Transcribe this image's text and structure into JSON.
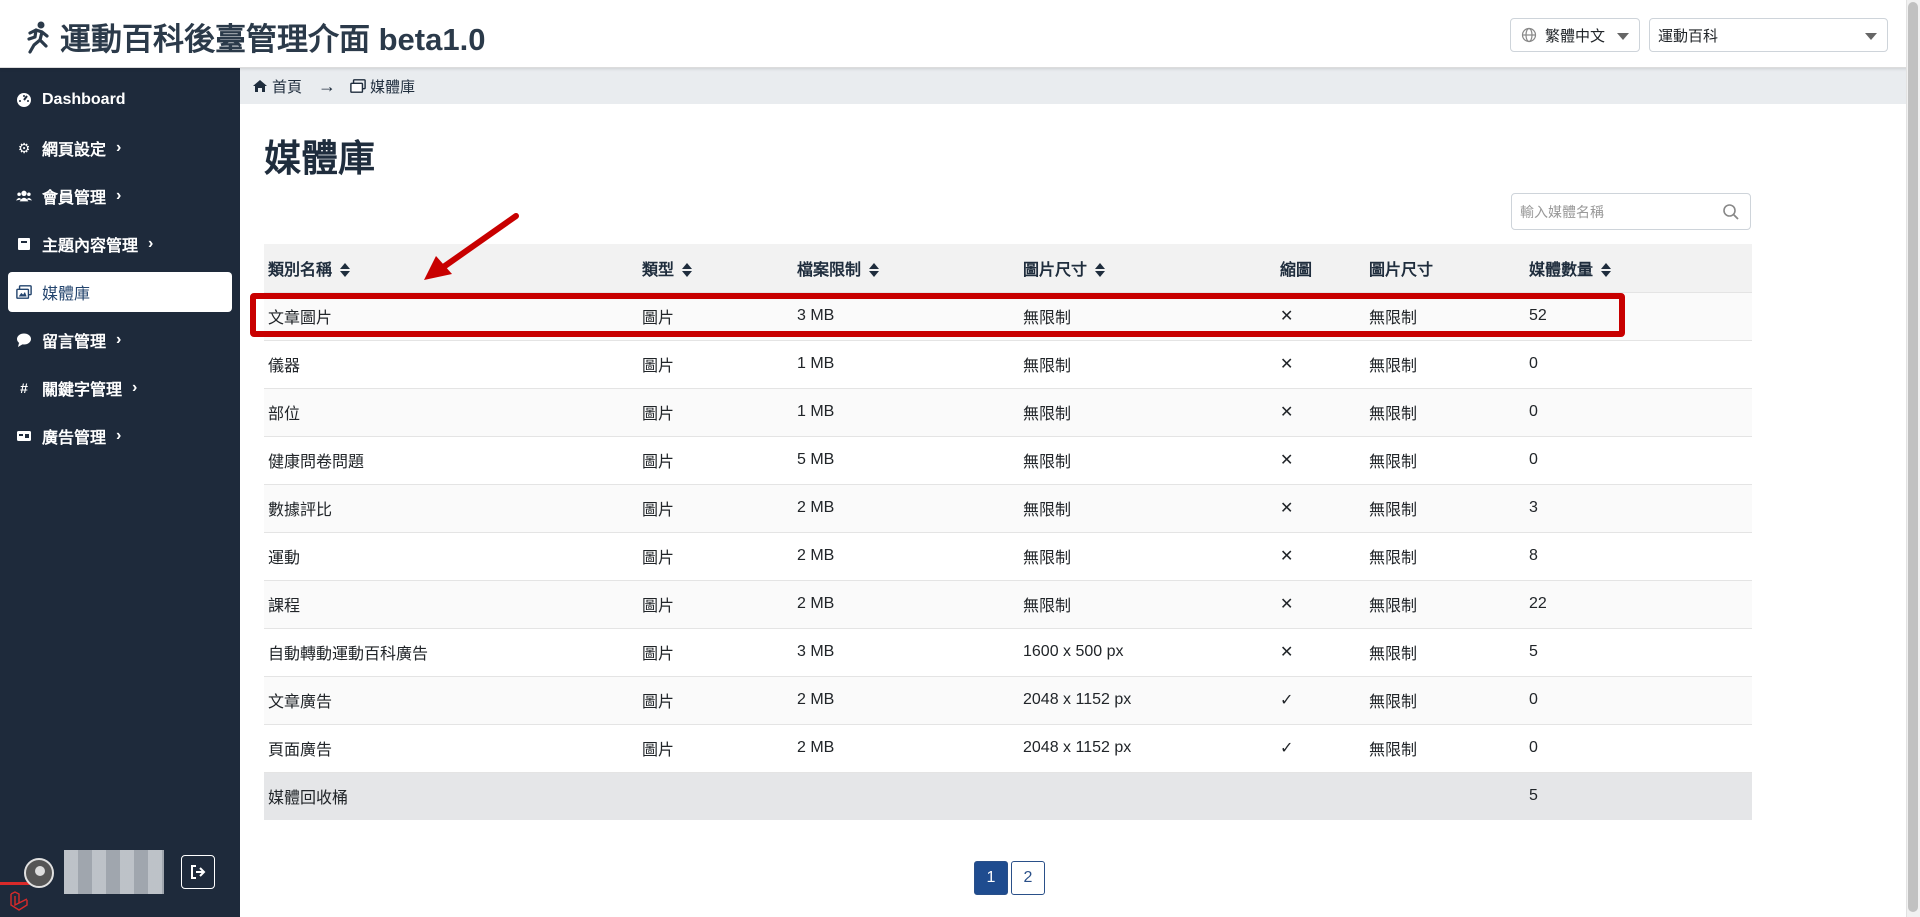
{
  "header": {
    "title": "運動百科後臺管理介面 beta1.0",
    "language_value": "繁體中文",
    "site_value": "運動百科"
  },
  "sidebar": {
    "items": [
      {
        "label": "Dashboard",
        "icon": "dashboard-icon"
      },
      {
        "label": "網頁設定",
        "icon": "gear-icon"
      },
      {
        "label": "會員管理",
        "icon": "users-icon"
      },
      {
        "label": "主題內容管理",
        "icon": "book-icon"
      },
      {
        "label": "媒體庫",
        "icon": "images-icon"
      },
      {
        "label": "留言管理",
        "icon": "comment-icon"
      },
      {
        "label": "關鍵字管理",
        "icon": "hashtag-icon"
      },
      {
        "label": "廣告管理",
        "icon": "ad-icon"
      }
    ],
    "active_index": 4
  },
  "breadcrumb": {
    "home": "首頁",
    "current": "媒體庫"
  },
  "page": {
    "title": "媒體庫",
    "search_placeholder": "輸入媒體名稱"
  },
  "table": {
    "headers": {
      "name": "類別名稱",
      "type": "類型",
      "file_limit": "檔案限制",
      "image_size": "圖片尺寸",
      "thumbnail": "縮圖",
      "thumb_size": "圖片尺寸",
      "count": "媒體數量"
    },
    "rows": [
      {
        "name": "文章圖片",
        "type": "圖片",
        "file_limit": "3 MB",
        "image_size": "無限制",
        "thumbnail": "✕",
        "thumb_size": "無限制",
        "count": "52"
      },
      {
        "name": "儀器",
        "type": "圖片",
        "file_limit": "1 MB",
        "image_size": "無限制",
        "thumbnail": "✕",
        "thumb_size": "無限制",
        "count": "0"
      },
      {
        "name": "部位",
        "type": "圖片",
        "file_limit": "1 MB",
        "image_size": "無限制",
        "thumbnail": "✕",
        "thumb_size": "無限制",
        "count": "0"
      },
      {
        "name": "健康問卷問題",
        "type": "圖片",
        "file_limit": "5 MB",
        "image_size": "無限制",
        "thumbnail": "✕",
        "thumb_size": "無限制",
        "count": "0"
      },
      {
        "name": "數據評比",
        "type": "圖片",
        "file_limit": "2 MB",
        "image_size": "無限制",
        "thumbnail": "✕",
        "thumb_size": "無限制",
        "count": "3"
      },
      {
        "name": "運動",
        "type": "圖片",
        "file_limit": "2 MB",
        "image_size": "無限制",
        "thumbnail": "✕",
        "thumb_size": "無限制",
        "count": "8"
      },
      {
        "name": "課程",
        "type": "圖片",
        "file_limit": "2 MB",
        "image_size": "無限制",
        "thumbnail": "✕",
        "thumb_size": "無限制",
        "count": "22"
      },
      {
        "name": "自動轉動運動百科廣告",
        "type": "圖片",
        "file_limit": "3 MB",
        "image_size": "1600 x 500 px",
        "thumbnail": "✕",
        "thumb_size": "無限制",
        "count": "5"
      },
      {
        "name": "文章廣告",
        "type": "圖片",
        "file_limit": "2 MB",
        "image_size": "2048 x 1152 px",
        "thumbnail": "✓",
        "thumb_size": "無限制",
        "count": "0"
      },
      {
        "name": "頁面廣告",
        "type": "圖片",
        "file_limit": "2 MB",
        "image_size": "2048 x 1152 px",
        "thumbnail": "✓",
        "thumb_size": "無限制",
        "count": "0"
      }
    ],
    "recycle": {
      "name": "媒體回收桶",
      "count": "5"
    }
  },
  "pagination": {
    "pages": [
      "1",
      "2"
    ],
    "current": "1"
  },
  "colors": {
    "sidebar_bg": "#1e2a3b",
    "accent": "#1f4c8f",
    "highlight": "#c80000"
  }
}
